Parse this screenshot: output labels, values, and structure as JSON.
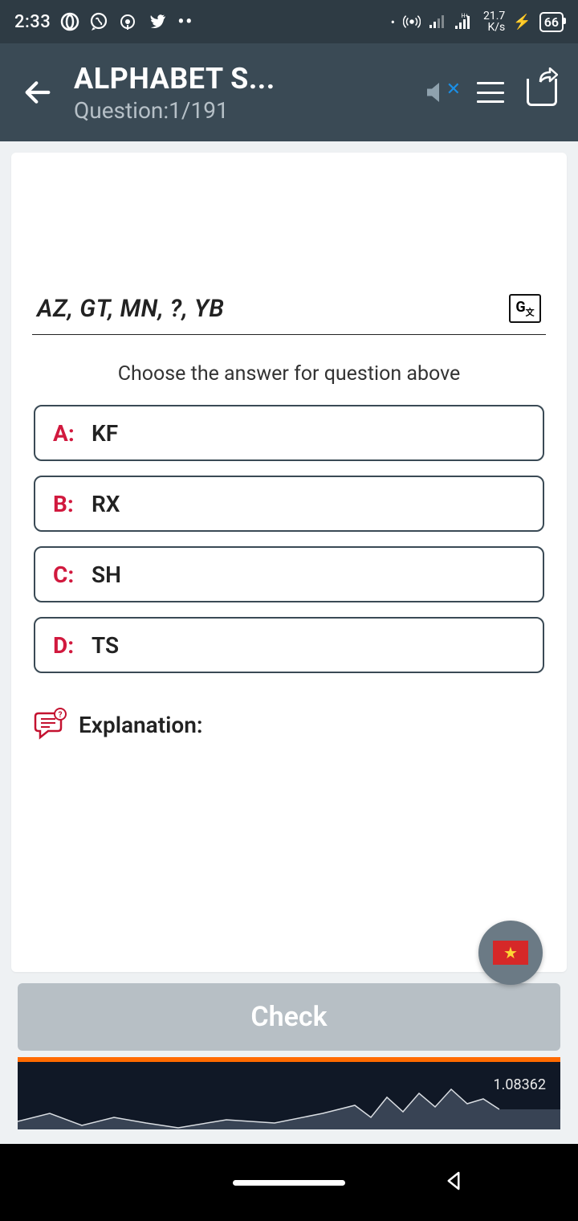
{
  "statusbar": {
    "time": "2:33",
    "net_speed_top": "21.7",
    "net_speed_unit": "K/s",
    "battery": "66"
  },
  "appbar": {
    "title": "ALPHABET S...",
    "subtitle": "Question:1/191"
  },
  "question": {
    "text": "AZ, GT, MN, ?, YB",
    "prompt": "Choose the answer for question above"
  },
  "options": [
    {
      "letter": "A:",
      "text": "KF"
    },
    {
      "letter": "B:",
      "text": "RX"
    },
    {
      "letter": "C:",
      "text": "SH"
    },
    {
      "letter": "D:",
      "text": "TS"
    }
  ],
  "explanation": {
    "label": "Explanation:"
  },
  "check": {
    "label": "Check"
  },
  "ad": {
    "value": "1.08362"
  }
}
